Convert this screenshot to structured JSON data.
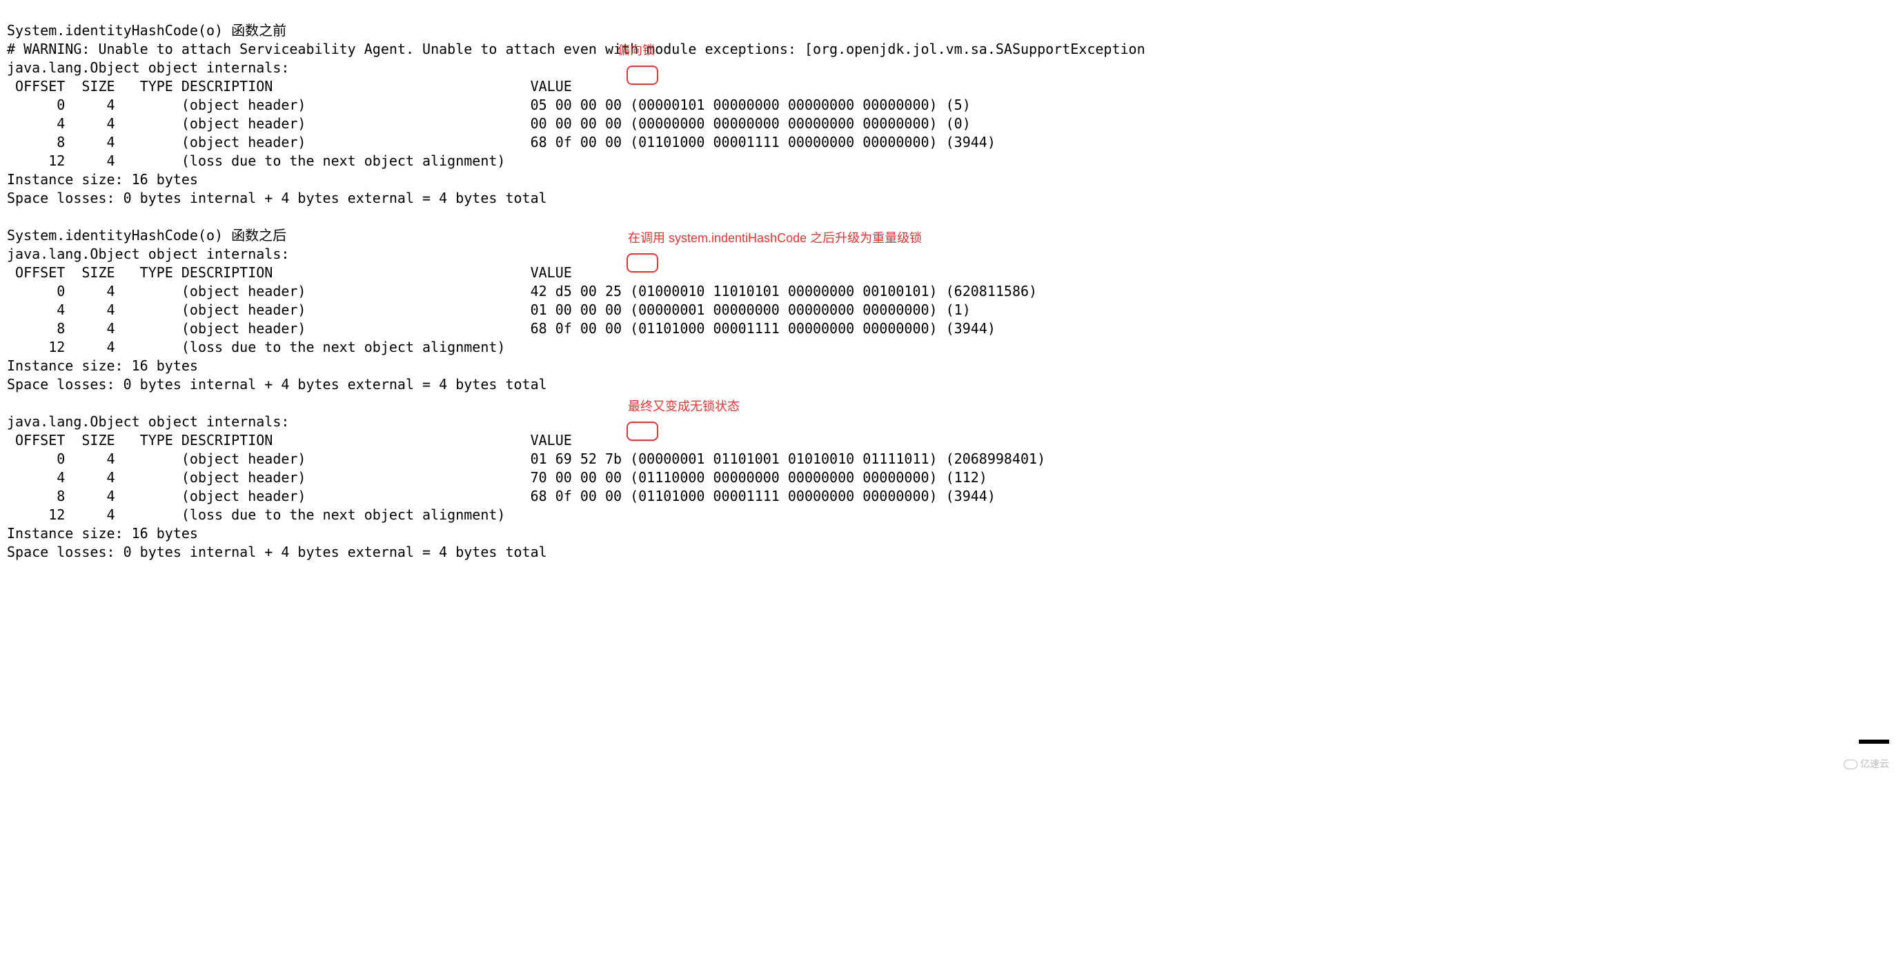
{
  "header1": "System.identityHashCode(o) 函数之前",
  "warning": "# WARNING: Unable to attach Serviceability Agent. Unable to attach even with module exceptions: [org.openjdk.jol.vm.sa.SASupportException",
  "internals_line": "java.lang.Object object internals:",
  "table_header": " OFFSET  SIZE   TYPE DESCRIPTION                               VALUE",
  "block1": {
    "r0": "      0     4        (object header)                           05 00 00 00 (00000101 00000000 00000000 00000000) (5)",
    "r1": "      4     4        (object header)                           00 00 00 00 (00000000 00000000 00000000 00000000) (0)",
    "r2": "      8     4        (object header)                           68 0f 00 00 (01101000 00001111 00000000 00000000) (3944)",
    "r3": "     12     4        (loss due to the next object alignment)"
  },
  "instance_line": "Instance size: 16 bytes",
  "space_line": "Space losses: 0 bytes internal + 4 bytes external = 4 bytes total",
  "header2": "System.identityHashCode(o) 函数之后",
  "block2": {
    "r0": "      0     4        (object header)                           42 d5 00 25 (01000010 11010101 00000000 00100101) (620811586)",
    "r1": "      4     4        (object header)                           01 00 00 00 (00000001 00000000 00000000 00000000) (1)",
    "r2": "      8     4        (object header)                           68 0f 00 00 (01101000 00001111 00000000 00000000) (3944)",
    "r3": "     12     4        (loss due to the next object alignment)"
  },
  "block3": {
    "r0": "      0     4        (object header)                           01 69 52 7b (00000001 01101001 01010010 01111011) (2068998401)",
    "r1": "      4     4        (object header)                           70 00 00 00 (01110000 00000000 00000000 00000000) (112)",
    "r2": "      8     4        (object header)                           68 0f 00 00 (01101000 00001111 00000000 00000000) (3944)",
    "r3": "     12     4        (loss due to the next object alignment)"
  },
  "anno1": "偏向锁",
  "anno2": "在调用 system.indentiHashCode 之后升级为重量级锁",
  "anno3": "最终又变成无锁状态",
  "watermark": "亿速云"
}
